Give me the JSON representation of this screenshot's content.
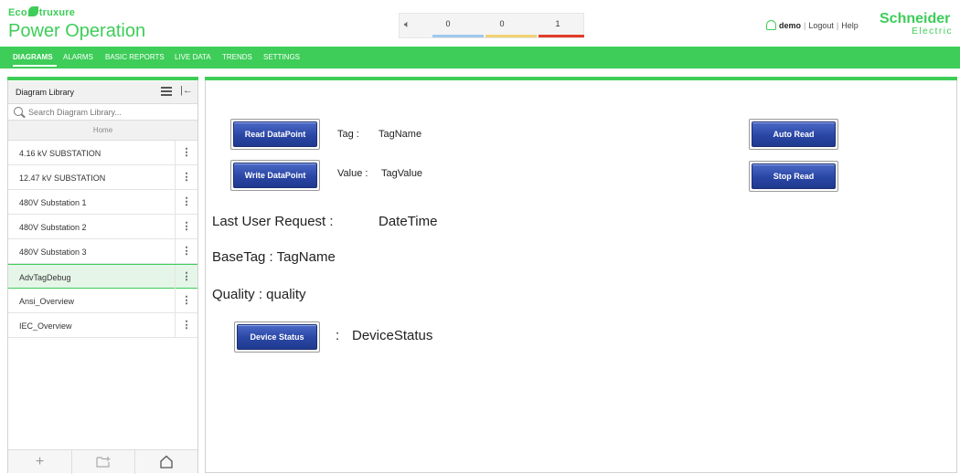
{
  "header": {
    "brand_small": "Eco",
    "brand_small_suffix": "truxure",
    "brand_title": "Power Operation",
    "alarm_counts": [
      "0",
      "0",
      "1"
    ],
    "alarm_colors": [
      "#9fc9ee",
      "#f1d272",
      "#e23c2a"
    ],
    "user": "demo",
    "logout": "Logout",
    "help": "Help",
    "logo_top": "Schneider",
    "logo_bottom": "Electric",
    "brand_color": "#3dcd58"
  },
  "nav": {
    "items": [
      "DIAGRAMS",
      "ALARMS",
      "BASIC REPORTS",
      "LIVE DATA",
      "TRENDS",
      "SETTINGS"
    ],
    "active": "DIAGRAMS"
  },
  "sidebar": {
    "title": "Diagram Library",
    "search_placeholder": "Search Diagram Library...",
    "home_label": "Home",
    "items": [
      {
        "label": "4.16 kV SUBSTATION"
      },
      {
        "label": "12.47 kV SUBSTATION"
      },
      {
        "label": "480V Substation 1"
      },
      {
        "label": "480V Substation 2"
      },
      {
        "label": "480V Substation 3"
      },
      {
        "label": "AdvTagDebug",
        "selected": true
      },
      {
        "label": "Ansi_Overview"
      },
      {
        "label": "IEC_Overview"
      }
    ],
    "footer_icons": [
      "plus-icon",
      "new-folder-icon",
      "home-icon"
    ]
  },
  "main": {
    "read_button": "Read DataPoint",
    "write_button": "Write DataPoint",
    "auto_read_button": "Auto Read",
    "stop_read_button": "Stop Read",
    "device_status_button": "Device Status",
    "tag_label": "Tag :",
    "tag_value": "TagName",
    "value_label": "Value :",
    "value_value": "TagValue",
    "last_request_label": "Last User Request :",
    "last_request_value": "DateTime",
    "basetag_text": "BaseTag : TagName",
    "quality_text": "Quality : quality",
    "device_status_sep": ":",
    "device_status_value": "DeviceStatus"
  }
}
